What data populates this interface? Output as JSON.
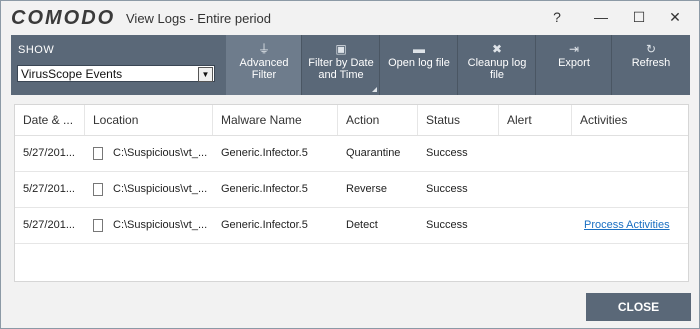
{
  "window": {
    "logo": "COMODO",
    "title": "View Logs - Entire period",
    "help": "?",
    "minimize": "—",
    "maximize": "☐",
    "close": "✕"
  },
  "toolbar": {
    "show_label": "SHOW",
    "show_value": "VirusScope Events",
    "buttons": [
      {
        "icon": "filter-icon",
        "glyph": "⏚",
        "line1": "Advanced",
        "line2": "Filter"
      },
      {
        "icon": "calendar-icon",
        "glyph": "▣",
        "line1": "Filter by Date",
        "line2": "and Time"
      },
      {
        "icon": "folder-icon",
        "glyph": "▬",
        "line1": "Open log file",
        "line2": ""
      },
      {
        "icon": "x-icon",
        "glyph": "✖",
        "line1": "Cleanup log",
        "line2": "file"
      },
      {
        "icon": "export-icon",
        "glyph": "⇥",
        "line1": "Export",
        "line2": ""
      },
      {
        "icon": "refresh-icon",
        "glyph": "↻",
        "line1": "Refresh",
        "line2": ""
      }
    ]
  },
  "table": {
    "columns": [
      "Date & ...",
      "Location",
      "Malware Name",
      "Action",
      "Status",
      "Alert",
      "Activities"
    ],
    "rows": [
      {
        "date": "5/27/201...",
        "location": "C:\\Suspicious\\vt_...",
        "malware": "Generic.Infector.5",
        "action": "Quarantine",
        "status": "Success",
        "alert": "",
        "activities": ""
      },
      {
        "date": "5/27/201...",
        "location": "C:\\Suspicious\\vt_...",
        "malware": "Generic.Infector.5",
        "action": "Reverse",
        "status": "Success",
        "alert": "",
        "activities": ""
      },
      {
        "date": "5/27/201...",
        "location": "C:\\Suspicious\\vt_...",
        "malware": "Generic.Infector.5",
        "action": "Detect",
        "status": "Success",
        "alert": "",
        "activities": "Process Activities"
      }
    ]
  },
  "footer": {
    "close_label": "CLOSE"
  },
  "colors": {
    "toolbar": "#5a6878",
    "link": "#1a6fc2"
  }
}
